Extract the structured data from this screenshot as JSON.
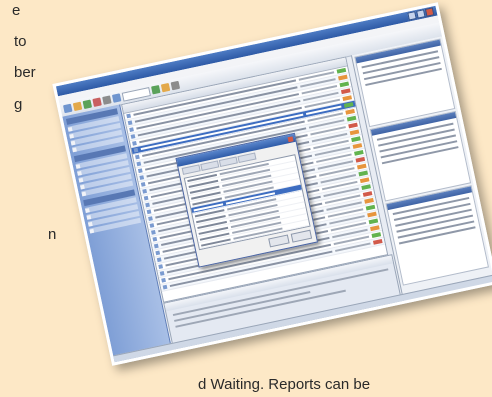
{
  "page_text": {
    "line1": "e",
    "line2": "to",
    "line3": "ber",
    "line4": "g",
    "line5": "n",
    "bottom_line": "d Waiting. Reports can be"
  },
  "colors": {
    "background": "#fde8c6",
    "window_title": "#2e5aa6",
    "selection": "#3d6dc1"
  },
  "screenshot": {
    "icon": "application-window-icon"
  }
}
